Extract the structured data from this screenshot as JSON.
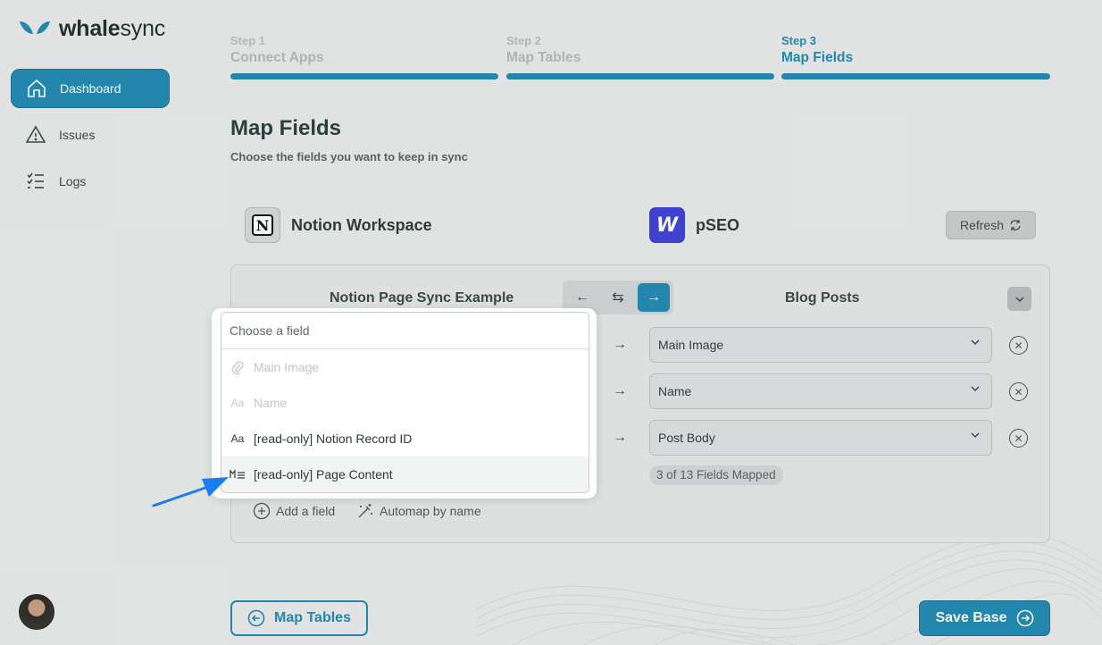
{
  "brand": {
    "name_bold": "whale",
    "name_rest": "sync"
  },
  "sidebar": {
    "items": [
      {
        "label": "Dashboard",
        "icon": "home-icon",
        "active": true
      },
      {
        "label": "Issues",
        "icon": "warning-icon",
        "active": false
      },
      {
        "label": "Logs",
        "icon": "checklist-icon",
        "active": false
      }
    ]
  },
  "steps": [
    {
      "num": "Step 1",
      "name": "Connect Apps"
    },
    {
      "num": "Step 2",
      "name": "Map Tables"
    },
    {
      "num": "Step 3",
      "name": "Map Fields"
    }
  ],
  "page": {
    "title": "Map Fields",
    "subtitle": "Choose the fields you want to keep in sync"
  },
  "apps": {
    "left": {
      "name": "Notion Workspace",
      "icon": "notion-logo"
    },
    "right": {
      "name": "pSEO",
      "icon": "webflow-logo"
    },
    "refresh_label": "Refresh"
  },
  "mapping": {
    "left_table": "Notion Page Sync Example",
    "right_table": "Blog Posts",
    "rows": [
      {
        "right_field": "Main Image"
      },
      {
        "right_field": "Name"
      },
      {
        "right_field": "Post Body"
      }
    ],
    "count_label": "3 of 13 Fields Mapped",
    "add_field_label": "Add a field",
    "automap_label": "Automap by name"
  },
  "dropdown": {
    "placeholder": "Choose a field",
    "options": [
      {
        "label": "Main Image",
        "icon": "paperclip-icon",
        "disabled": true
      },
      {
        "label": "Name",
        "icon": "text-icon",
        "disabled": true
      },
      {
        "label": "[read-only] Notion Record ID",
        "icon": "text-icon",
        "disabled": false
      },
      {
        "label": "[read-only] Page Content",
        "icon": "markdown-icon",
        "disabled": false
      }
    ]
  },
  "footer": {
    "back_label": "Map Tables",
    "save_label": "Save Base"
  },
  "colors": {
    "accent": "#1f87b0",
    "background": "#e9eaea"
  }
}
